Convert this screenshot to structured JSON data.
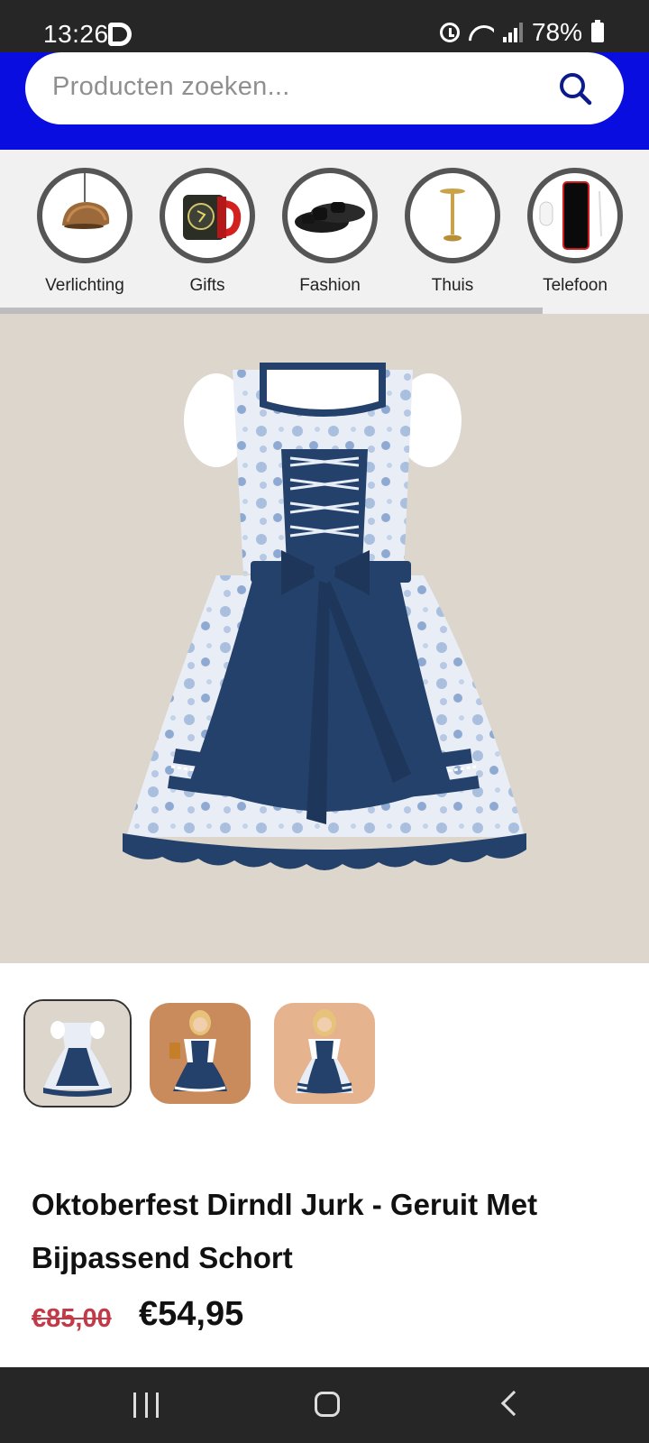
{
  "status_bar": {
    "time": "13:26",
    "battery": "78%"
  },
  "search": {
    "placeholder": "Producten zoeken..."
  },
  "categories": [
    {
      "label": "Verlichting",
      "icon": "pendant-lamp-icon"
    },
    {
      "label": "Gifts",
      "icon": "mug-icon"
    },
    {
      "label": "Fashion",
      "icon": "sandals-icon"
    },
    {
      "label": "Thuis",
      "icon": "table-lamp-icon"
    },
    {
      "label": "Telefoon",
      "icon": "phone-icon"
    }
  ],
  "product": {
    "title": "Oktoberfest Dirndl Jurk - Geruit Met Bijpassend Schort",
    "price_old": "€85,00",
    "price_new": "€54,95"
  },
  "colors": {
    "header_blue": "#0a0de0",
    "old_price_red": "#c23a48",
    "dress_navy": "#24416b"
  }
}
